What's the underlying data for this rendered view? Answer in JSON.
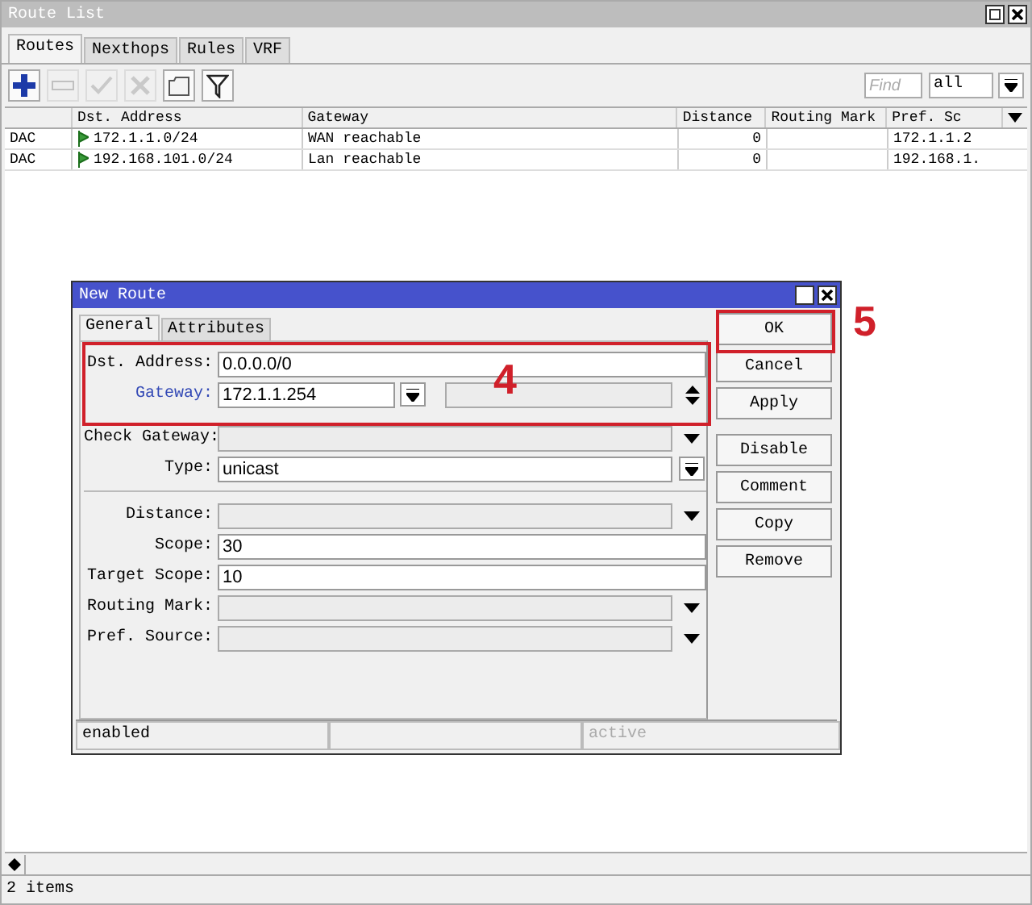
{
  "window": {
    "title": "Route List"
  },
  "tabs": [
    {
      "label": "Routes",
      "selected": true
    },
    {
      "label": "Nexthops",
      "selected": false
    },
    {
      "label": "Rules",
      "selected": false
    },
    {
      "label": "VRF",
      "selected": false
    }
  ],
  "toolbar": [
    {
      "kind": "add",
      "disabled": false
    },
    {
      "kind": "remove",
      "disabled": true
    },
    {
      "kind": "enable",
      "disabled": true
    },
    {
      "kind": "disable",
      "disabled": true
    },
    {
      "kind": "comment",
      "disabled": false
    },
    {
      "kind": "filter",
      "disabled": false
    }
  ],
  "find": {
    "placeholder": "Find"
  },
  "filter_select": {
    "value": "all"
  },
  "table": {
    "columns": [
      "Dst. Address",
      "Gateway",
      "Distance",
      "Routing Mark",
      "Pref. Sc"
    ],
    "rows": [
      {
        "flags": "DAC",
        "dst_address": "172.1.1.0/24",
        "gateway": "WAN reachable",
        "distance": "0",
        "pref_source": "172.1.1.2"
      },
      {
        "flags": "DAC",
        "dst_address": "192.168.101.0/24",
        "gateway": "Lan reachable",
        "distance": "0",
        "pref_source": "192.168.1."
      }
    ]
  },
  "status_bar": "2 items",
  "dialog": {
    "title": "New Route",
    "tabs": [
      {
        "label": "General",
        "selected": true
      },
      {
        "label": "Attributes",
        "selected": false
      }
    ],
    "field_groups": [
      [
        {
          "label": "Dst. Address:",
          "kind": "text",
          "value": "0.0.0.0/0"
        },
        {
          "label": "Gateway:",
          "kind": "gateway",
          "value": "172.1.1.254"
        },
        {
          "label": "Check Gateway:",
          "kind": "select"
        },
        {
          "label": "Type:",
          "kind": "combo",
          "value": "unicast"
        }
      ],
      [
        {
          "label": "Distance:",
          "kind": "select"
        },
        {
          "label": "Scope:",
          "kind": "text",
          "value": "30"
        },
        {
          "label": "Target Scope:",
          "kind": "text",
          "value": "10"
        },
        {
          "label": "Routing Mark:",
          "kind": "select"
        },
        {
          "label": "Pref. Source:",
          "kind": "select"
        }
      ]
    ],
    "button_groups": [
      [
        "OK",
        "Cancel",
        "Apply"
      ],
      [
        "Disable",
        "Comment",
        "Copy",
        "Remove"
      ]
    ],
    "status": [
      {
        "text": "enabled",
        "disabled": false
      },
      {
        "text": "active",
        "disabled": true
      }
    ]
  },
  "annotations": [
    {
      "label": "4"
    },
    {
      "label": "5"
    }
  ]
}
